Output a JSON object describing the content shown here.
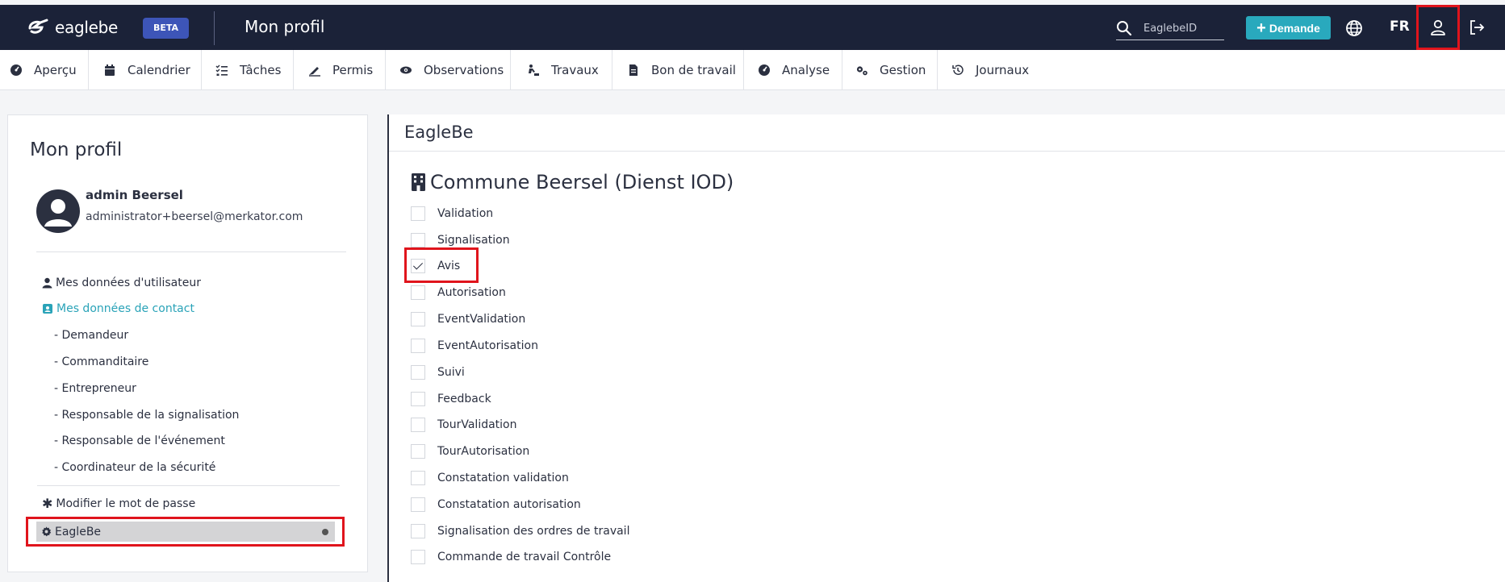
{
  "header": {
    "logo_text": "eaglebe",
    "beta_badge": "BETA",
    "page_title": "Mon profil",
    "search_placeholder": "EaglebeID",
    "demande_label": "Demande",
    "language": "FR"
  },
  "nav": {
    "items": [
      {
        "label": "Aperçu",
        "icon": "gauge-icon"
      },
      {
        "label": "Calendrier",
        "icon": "calendar-icon"
      },
      {
        "label": "Tâches",
        "icon": "task-list-icon"
      },
      {
        "label": "Permis",
        "icon": "signature-icon"
      },
      {
        "label": "Observations",
        "icon": "eye-icon"
      },
      {
        "label": "Travaux",
        "icon": "worker-icon"
      },
      {
        "label": "Bon de travail",
        "icon": "document-icon"
      },
      {
        "label": "Analyse",
        "icon": "gauge-icon"
      },
      {
        "label": "Gestion",
        "icon": "gears-icon"
      },
      {
        "label": "Journaux",
        "icon": "history-icon"
      }
    ]
  },
  "profile": {
    "title": "Mon profil",
    "name": "admin Beersel",
    "email": "administrator+beersel@merkator.com",
    "menu": {
      "user_data": "Mes données d'utilisateur",
      "contact_data": "Mes données de contact",
      "sub_items": [
        "- Demandeur",
        "- Commanditaire",
        "- Entrepreneur",
        "- Responsable de la signalisation",
        "- Responsable de l'événement",
        "- Coordinateur de la sécurité"
      ],
      "change_password": "Modifier le mot de passe",
      "eaglebe": "EagleBe"
    }
  },
  "panel": {
    "title": "EagleBe",
    "commune": "Commune Beersel (Dienst IOD)",
    "options": [
      {
        "label": "Validation",
        "checked": false
      },
      {
        "label": "Signalisation",
        "checked": false
      },
      {
        "label": "Avis",
        "checked": true
      },
      {
        "label": "Autorisation",
        "checked": false
      },
      {
        "label": "EventValidation",
        "checked": false
      },
      {
        "label": "EventAutorisation",
        "checked": false
      },
      {
        "label": "Suivi",
        "checked": false
      },
      {
        "label": "Feedback",
        "checked": false
      },
      {
        "label": "TourValidation",
        "checked": false
      },
      {
        "label": "TourAutorisation",
        "checked": false
      },
      {
        "label": "Constatation validation",
        "checked": false
      },
      {
        "label": "Constatation autorisation",
        "checked": false
      },
      {
        "label": "Signalisation des ordres de travail",
        "checked": false
      },
      {
        "label": "Commande de travail Contrôle",
        "checked": false
      }
    ]
  },
  "colors": {
    "header_bg": "#1b2238",
    "accent": "#29a9bd",
    "highlight_border": "#e0141c"
  }
}
